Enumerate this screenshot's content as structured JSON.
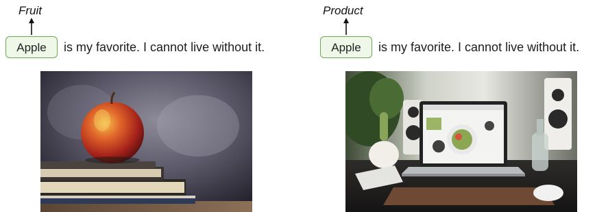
{
  "left": {
    "category": "Fruit",
    "entity": "Apple",
    "sentence_rest": "is my favorite. I cannot live without it.",
    "image_icon": "apple-on-books-photo"
  },
  "right": {
    "category": "Product",
    "entity": "Apple",
    "sentence_rest": "is my favorite. I cannot live without it.",
    "image_icon": "laptop-on-desk-photo"
  },
  "colors": {
    "entity_border": "#6aa84f",
    "entity_fill": "#eef7e8"
  }
}
